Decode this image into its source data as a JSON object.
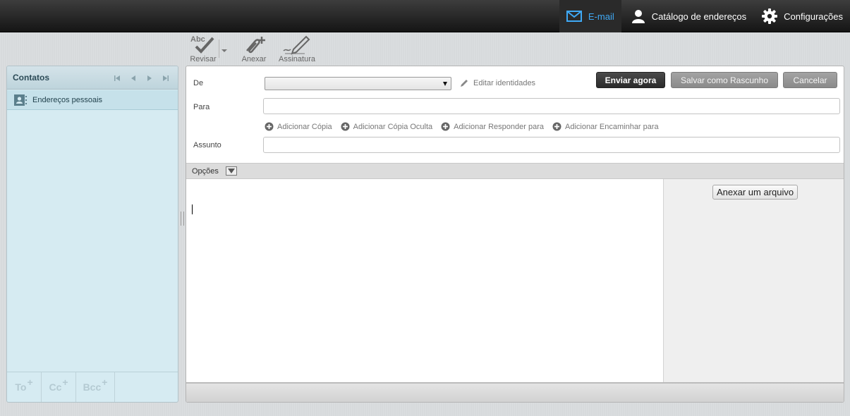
{
  "nav": {
    "email_label": "E-mail",
    "address_book_label": "Catálogo de endereços",
    "settings_label": "Configurações"
  },
  "toolbar": {
    "spell_icon_text": "Abc",
    "spell_label": "Revisar",
    "attach_label": "Anexar",
    "signature_label": "Assinatura"
  },
  "contacts": {
    "title": "Contatos",
    "items": [
      {
        "label": "Endereços pessoais"
      }
    ],
    "footer": {
      "to_label": "To",
      "cc_label": "Cc",
      "bcc_label": "Bcc",
      "plus": "+"
    }
  },
  "compose": {
    "from_label": "De",
    "from_value": "",
    "edit_identities_label": "Editar identidades",
    "send_label": "Enviar agora",
    "draft_label": "Salvar como Rascunho",
    "cancel_label": "Cancelar",
    "to_label": "Para",
    "to_value": "",
    "add_links": [
      {
        "label": "Adicionar Cópia"
      },
      {
        "label": "Adicionar Cópia Oculta"
      },
      {
        "label": "Adicionar Responder para"
      },
      {
        "label": "Adicionar Encaminhar para"
      }
    ],
    "subject_label": "Assunto",
    "subject_value": "",
    "options_label": "Opções",
    "attach_file_label": "Anexar um arquivo"
  },
  "colors": {
    "accent": "#3fa9f5",
    "topbar": "#1c1c1c",
    "contacts_bg": "#d6ebf2"
  }
}
